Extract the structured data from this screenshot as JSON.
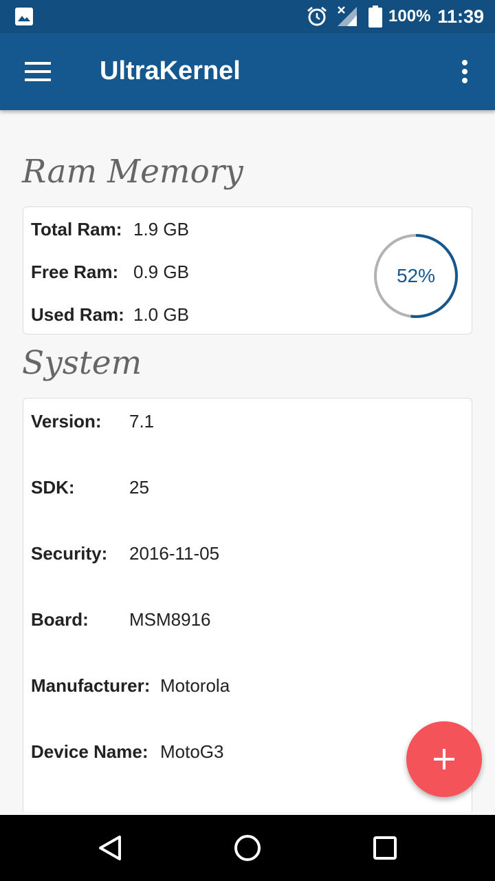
{
  "status_bar": {
    "battery_percent": "100%",
    "time": "11:39",
    "icons": [
      "image-icon",
      "alarm-icon",
      "signal-icon",
      "battery-icon"
    ]
  },
  "app_bar": {
    "title": "UltraKernel",
    "icons": [
      "menu-icon",
      "more-vert-icon"
    ]
  },
  "ram": {
    "heading": "Ram Memory",
    "rows": [
      {
        "label": "Total Ram:",
        "value": "1.9 GB"
      },
      {
        "label": "Free Ram:",
        "value": "0.9 GB"
      },
      {
        "label": "Used Ram:",
        "value": "1.0 GB"
      }
    ],
    "usage_text": "52%",
    "usage_fraction": 0.52
  },
  "system": {
    "heading": "System",
    "rows": [
      {
        "label": "Version:",
        "value": "7.1"
      },
      {
        "label": "SDK:",
        "value": "25"
      },
      {
        "label": "Security:",
        "value": "2016-11-05"
      },
      {
        "label": "Board:",
        "value": "MSM8916"
      },
      {
        "label": "Manufacturer:",
        "value": "Motorola"
      },
      {
        "label": "Device Name:",
        "value": "MotoG3"
      }
    ]
  },
  "fab": {
    "icon": "plus-icon"
  },
  "nav_bar": {
    "icons": [
      "back-icon",
      "home-icon",
      "recents-icon"
    ]
  },
  "colors": {
    "primary": "#15578f",
    "status_bar": "#124e80",
    "accent": "#f4535a",
    "gauge_track": "#b3b3b3"
  }
}
